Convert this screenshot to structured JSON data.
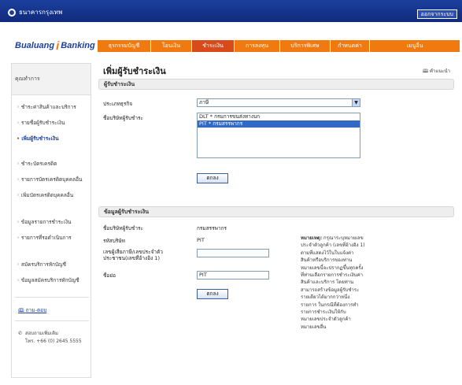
{
  "topbar": {
    "bank_name": "ธนาคารกรุงเทพ",
    "logout_label": "ออกจากระบบ"
  },
  "brand": {
    "text_left": "Bualuang",
    "text_i": "i",
    "text_right": "Banking"
  },
  "nav": {
    "items": [
      {
        "label": "ธุรกรรมบัญชี"
      },
      {
        "label": "โอนเงิน"
      },
      {
        "label": "ชำระเงิน"
      },
      {
        "label": "การลงทุน"
      },
      {
        "label": "บริการพิเศษ"
      },
      {
        "label": "กำหนดค่า"
      },
      {
        "label": "เมนูอื่น"
      }
    ]
  },
  "sidebar": {
    "header": "คุณทำการ",
    "items": [
      {
        "label": "ชำระค่าสินค้าและบริการ"
      },
      {
        "label": "รายชื่อผู้รับชำระเงิน"
      },
      {
        "label": "เพิ่มผู้รับชำระเงิน"
      },
      {
        "label": "ชำระบัตรเครดิต"
      },
      {
        "label": "รายการบัตรเครดิตบุคคลอื่น"
      },
      {
        "label": "เพิ่มบัตรเครดิตบุคคลอื่น"
      },
      {
        "label": "ข้อมูลรายการชำระเงิน"
      },
      {
        "label": "รายการที่รอดำเนินการ"
      },
      {
        "label": "สมัครบริการหักบัญชี"
      },
      {
        "label": "ข้อมูลสมัครบริการหักบัญชี"
      }
    ],
    "help_label": "ถาม-ตอบ",
    "contact_label": "สอบถามเพิ่มเติม",
    "contact_phone": "โทร. +66 (0) 2645 5555"
  },
  "main": {
    "title": "เพิ่มผู้รับชำระเงิน",
    "help_link": "คำแนะนำ",
    "section1": {
      "title": "ผู้รับชำระเงิน",
      "type_label": "ประเภทธุรกิจ",
      "type_value": "ภาษี",
      "biller_label": "ชื่อบริษัทผู้รับชำระ",
      "biller_options": [
        "DLT * กรมการขนส่งทางบก",
        "PIT * กรมสรรพากร"
      ],
      "submit": "ตกลง"
    },
    "section2": {
      "title": "ข้อมูลผู้รับชำระเงิน",
      "company_label": "ชื่อบริษัทผู้รับชำระ",
      "company_value": "กรมสรรพากร",
      "code_label": "รหัสบริษัท",
      "code_value": "PIT",
      "ref_label": "เลขผู้เสียภาษี/เลขประจำตัวประชาชน(เลขที่อ้างอิง 1)",
      "ref_value": "",
      "nick_label": "ชื่อย่อ",
      "nick_value": "PIT",
      "submit": "ตกลง",
      "note_title": "หมายเหตุ:",
      "note_text": "กรุณาระบุหมายเลขประจำตัวลูกค้า (เลขที่อ้างอิง 1) ตามที่แสดงไว้ในใบแจ้งค่าสินค้าหรือบริการของท่าน หมายเลขนี้จะปรากฏขึ้นทุกครั้งที่ท่านเลือกรายการชำระเงินค่าสินค้าและบริการ โดยท่านสามารถสร้างข้อมูลผู้รับชำระรายเดียวได้มากกว่าหนึ่งรายการ ในกรณีที่ต้องการทำรายการชำระเงินให้กับหมายเลขประจำตัวลูกค้าหมายเลขอื่น"
    }
  }
}
